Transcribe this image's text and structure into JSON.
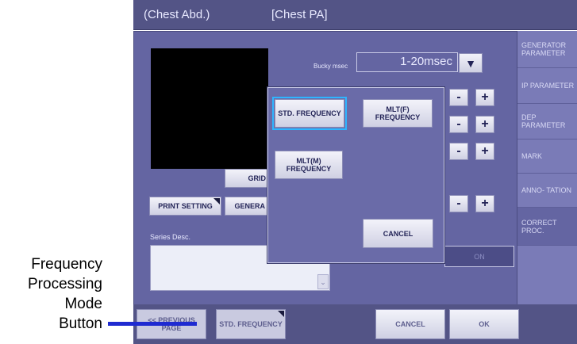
{
  "tabs": [
    "(Chest Abd.)",
    "[Chest PA]"
  ],
  "bucky": {
    "label": "Bucky msec",
    "value": "1-20msec"
  },
  "side_menu": [
    "GENERATOR PARAMETER",
    "IP PARAMETER",
    "DEP PARAMETER",
    "MARK",
    "ANNO- TATION",
    "CORRECT PROC."
  ],
  "left_buttons": {
    "grid": "GRID",
    "print_setting": "PRINT SETTING",
    "general": "GENERA"
  },
  "series_desc": {
    "label": "Series Desc.",
    "value": ""
  },
  "on_button": "ON",
  "popup": {
    "std_frequency": "STD. FREQUENCY",
    "mlt_f_frequency": "MLT(F) FREQUENCY",
    "mlt_m_frequency": "MLT(M) FREQUENCY",
    "cancel": "CANCEL"
  },
  "bottom_bar": {
    "previous_page": "<< PREVIOUS PAGE",
    "std_frequency": "STD. FREQUENCY",
    "cancel": "CANCEL",
    "ok": "OK"
  },
  "callout": {
    "line1": "Frequency",
    "line2": "Processing",
    "line3": "Mode",
    "line4": "Button"
  },
  "pm_rows": [
    {
      "minus": "-",
      "plus": "+"
    },
    {
      "minus": "-",
      "plus": "+"
    },
    {
      "minus": "-",
      "plus": "+"
    },
    {
      "minus": "-",
      "plus": "+"
    }
  ],
  "colors": {
    "accent": "#1f2bd1",
    "panel": "#6465a2"
  },
  "icons": [
    "dropdown-arrow-icon",
    "scroll-down-icon"
  ]
}
